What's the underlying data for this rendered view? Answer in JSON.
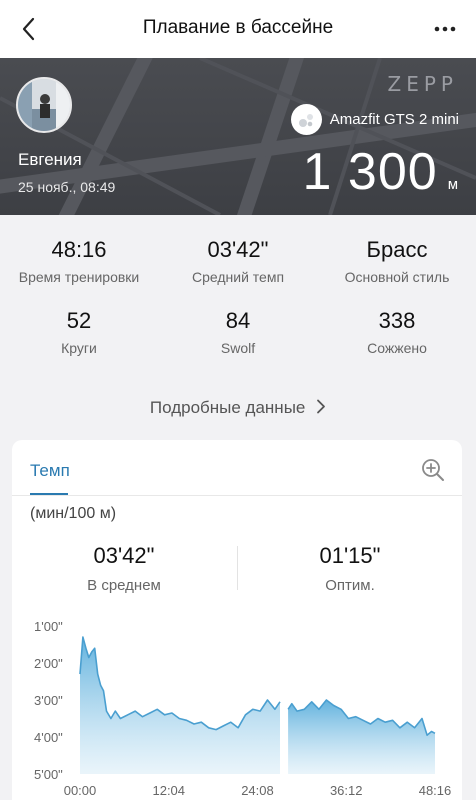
{
  "nav": {
    "title": "Плавание в бассейне",
    "back_icon": "chevron-left-icon",
    "more_icon": "more-horizontal-icon"
  },
  "header": {
    "brand": "ZEPP",
    "user_name": "Евгения",
    "date": "25 нояб., 08:49",
    "device": "Amazfit GTS 2 mini",
    "distance": "1 300",
    "distance_unit": "м"
  },
  "stats": [
    {
      "value": "48:16",
      "label": "Время тренировки"
    },
    {
      "value": "03'42\"",
      "label": "Средний темп"
    },
    {
      "value": "Брасс",
      "label": "Основной стиль"
    },
    {
      "value": "52",
      "label": "Круги"
    },
    {
      "value": "84",
      "label": "Swolf"
    },
    {
      "value": "338",
      "label": "Сожжено"
    }
  ],
  "details_link": "Подробные данные",
  "card": {
    "tab": "Темп",
    "unit": "(мин/100 м)",
    "average": {
      "value": "03'42\"",
      "label": "В среднем"
    },
    "optimal": {
      "value": "01'15\"",
      "label": "Оптим."
    }
  },
  "colors": {
    "accent": "#2a7ab0",
    "chart_line": "#4a9fd0",
    "banner": "#45474c"
  },
  "chart_data": {
    "type": "area",
    "title": "Темп",
    "ylabel": "(мин/100 м)",
    "x_ticks": [
      "00:00",
      "12:04",
      "24:08",
      "36:12",
      "48:16"
    ],
    "y_ticks": [
      "1'00\"",
      "2'00\"",
      "3'00\"",
      "4'00\"",
      "5'00\""
    ],
    "ylim_min": [
      1,
      5
    ],
    "xlim_min": [
      0,
      48.27
    ],
    "y_inverted": true,
    "grid": false,
    "series": [
      {
        "x": [
          0,
          0.4,
          0.8,
          1.2,
          1.6,
          2.0,
          2.4,
          2.8,
          3.2,
          3.6,
          4.2,
          4.8,
          5.5,
          6.5,
          7.5,
          8.5,
          9.5,
          10.5,
          11.5,
          12.5,
          13.5,
          14.5,
          15.5,
          16.5,
          17.5,
          18.5,
          19.5,
          20.5,
          21.5,
          22.5,
          23.5,
          24.5,
          25.5,
          26.5,
          27.2
        ],
        "y": [
          2.3,
          1.3,
          1.6,
          1.85,
          1.7,
          1.6,
          2.3,
          2.6,
          2.75,
          3.3,
          3.5,
          3.3,
          3.5,
          3.4,
          3.3,
          3.45,
          3.35,
          3.25,
          3.4,
          3.35,
          3.5,
          3.55,
          3.65,
          3.6,
          3.75,
          3.8,
          3.7,
          3.6,
          3.75,
          3.4,
          3.25,
          3.3,
          3.0,
          3.25,
          3.05
        ]
      },
      {
        "x": [
          28.3,
          28.8,
          29.5,
          30.5,
          31.5,
          32.5,
          33.5,
          34.5,
          35.5,
          36.5,
          37.5,
          38.5,
          39.5,
          40.5,
          41.5,
          42.5,
          43.5,
          44.5,
          45.5,
          46.5,
          47.2,
          47.8,
          48.27
        ],
        "y": [
          3.25,
          3.1,
          3.3,
          3.25,
          3.05,
          3.25,
          3.0,
          3.15,
          3.25,
          3.5,
          3.45,
          3.55,
          3.65,
          3.5,
          3.6,
          3.55,
          3.75,
          3.6,
          3.75,
          3.5,
          3.95,
          3.85,
          3.9
        ]
      }
    ]
  }
}
